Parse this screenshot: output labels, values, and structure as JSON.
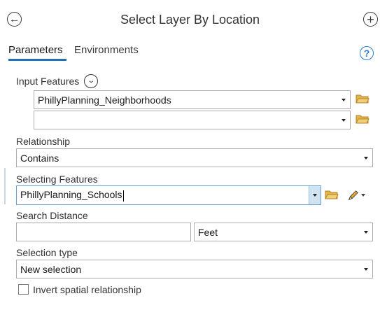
{
  "header": {
    "title": "Select Layer By Location",
    "back_icon": "back-arrow-circle-icon",
    "add_icon": "plus-circle-icon"
  },
  "tabs": [
    {
      "label": "Parameters",
      "active": true
    },
    {
      "label": "Environments",
      "active": false
    }
  ],
  "help_icon": "help-question-icon",
  "input_features": {
    "label": "Input Features",
    "rows": [
      {
        "value": "PhillyPlanning_Neighborhoods"
      },
      {
        "value": ""
      }
    ]
  },
  "relationship": {
    "label": "Relationship",
    "value": "Contains"
  },
  "selecting_features": {
    "label": "Selecting Features",
    "value": "PhillyPlanning_Schools"
  },
  "search_distance": {
    "label": "Search Distance",
    "value": "",
    "unit": "Feet"
  },
  "selection_type": {
    "label": "Selection type",
    "value": "New selection"
  },
  "invert": {
    "label": "Invert spatial relationship",
    "checked": false
  },
  "colors": {
    "accent": "#1f72b8",
    "folder": "#e3b24a",
    "pencil": "#e0a82e",
    "help": "#2f7fd0"
  }
}
